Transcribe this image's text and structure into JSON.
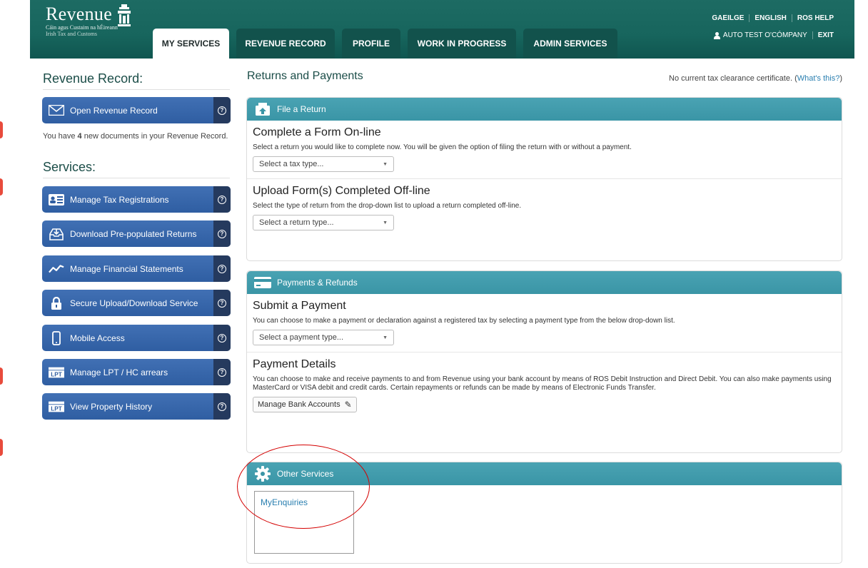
{
  "header": {
    "logo": {
      "word": "Revenue",
      "sub1": "Cáin agus Custaim na hÉireann",
      "sub2": "Irish Tax and Customs"
    },
    "tabs": [
      {
        "label": "MY SERVICES",
        "active": true
      },
      {
        "label": "REVENUE RECORD",
        "active": false
      },
      {
        "label": "PROFILE",
        "active": false
      },
      {
        "label": "WORK IN PROGRESS",
        "active": false
      },
      {
        "label": "ADMIN SERVICES",
        "active": false
      }
    ],
    "top_links": [
      "GAEILGE",
      "ENGLISH",
      "ROS HELP"
    ],
    "user_name": "AUTO TEST O'CÓMPANY",
    "exit_label": "EXIT"
  },
  "sidebar": {
    "record_title": "Revenue Record:",
    "open_record_label": "Open Revenue Record",
    "docs_note_prefix": "You have ",
    "docs_count": "4",
    "docs_note_suffix": " new documents in your Revenue Record.",
    "services_title": "Services:",
    "services": [
      {
        "label": "Manage Tax Registrations",
        "icon": "id-card-icon"
      },
      {
        "label": "Download Pre-populated Returns",
        "icon": "download-tray-icon"
      },
      {
        "label": "Manage Financial Statements",
        "icon": "line-chart-icon"
      },
      {
        "label": "Secure Upload/Download Service",
        "icon": "lock-icon"
      },
      {
        "label": "Mobile Access",
        "icon": "mobile-phone-icon"
      },
      {
        "label": "Manage LPT / HC arrears",
        "icon": "lpt-icon"
      },
      {
        "label": "View Property History",
        "icon": "lpt-icon"
      }
    ],
    "help_glyph": "?"
  },
  "main": {
    "title": "Returns and Payments",
    "clearance_text": "No current tax clearance certificate. (",
    "clearance_link": "What's this?",
    "clearance_close": ")",
    "file_return": {
      "header": "File a Return",
      "complete_title": "Complete a Form On-line",
      "complete_desc": "Select a return you would like to complete now. You will be given the option of filing the return with or without a payment.",
      "complete_select": "Select a tax type...",
      "upload_title": "Upload Form(s) Completed Off-line",
      "upload_desc": "Select the type of return from the drop-down list to upload a return completed off-line.",
      "upload_select": "Select a return type..."
    },
    "payments": {
      "header": "Payments & Refunds",
      "submit_title": "Submit a Payment",
      "submit_desc": "You can choose to make a payment or declaration against a registered tax by selecting a payment type from the below drop-down list.",
      "submit_select": "Select a payment type...",
      "details_title": "Payment Details",
      "details_desc": "You can choose to make and receive payments to and from Revenue using your bank account by means of ROS Debit Instruction and Direct Debit. You can also make payments using MasterCard or VISA debit and credit cards. Certain repayments or refunds can be made by means of Electronic Funds Transfer.",
      "bank_button": "Manage Bank Accounts"
    },
    "other_services": {
      "header": "Other Services",
      "link": "MyEnquiries"
    }
  },
  "colors": {
    "header_green": "#17655d",
    "panel_teal": "#3a95a6",
    "service_blue": "#2f5ea2",
    "annotation_red": "#d40000"
  }
}
